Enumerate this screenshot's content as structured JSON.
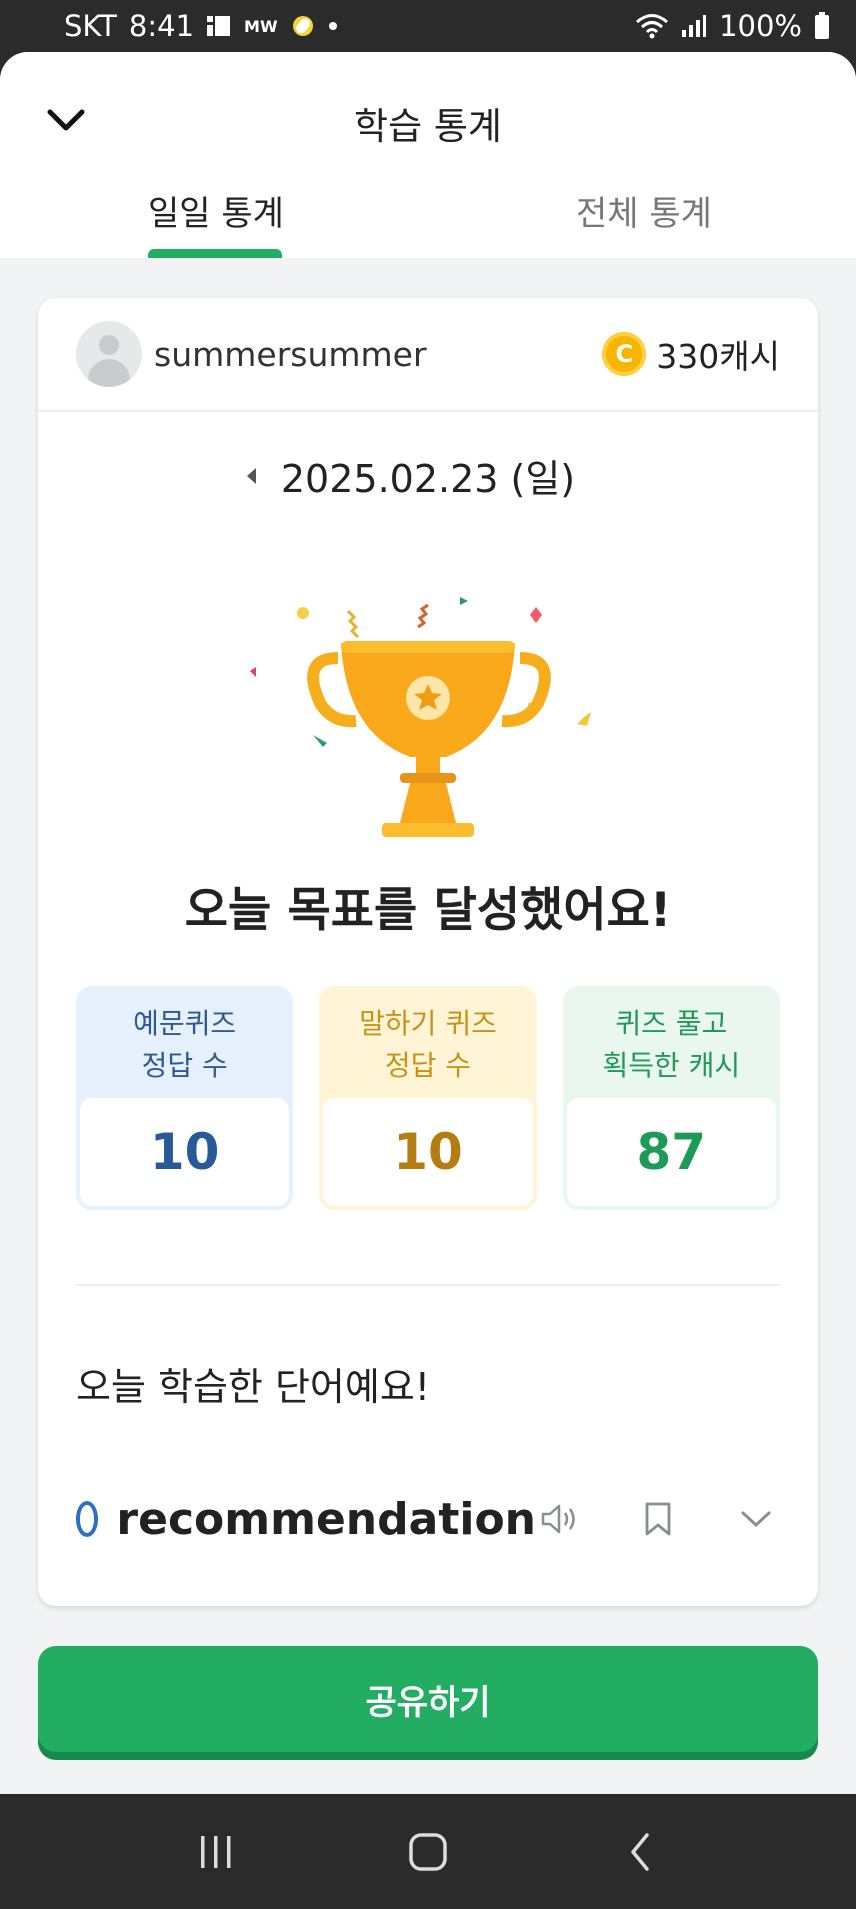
{
  "status_bar": {
    "carrier": "SKT",
    "time": "8:41",
    "battery": "100%"
  },
  "header": {
    "title": "학습 통계",
    "tabs": [
      {
        "label": "일일 통계",
        "active": true
      },
      {
        "label": "전체 통계",
        "active": false
      }
    ]
  },
  "profile": {
    "username": "summersummer",
    "cash": "330캐시"
  },
  "date": "2025.02.23 (일)",
  "goal_message": "오늘 목표를 달성했어요!",
  "stats": [
    {
      "label_line1": "예문퀴즈",
      "label_line2": "정답 수",
      "value": "10"
    },
    {
      "label_line1": "말하기 퀴즈",
      "label_line2": "정답 수",
      "value": "10"
    },
    {
      "label_line1": "퀴즈 풀고",
      "label_line2": "획득한 캐시",
      "value": "87"
    }
  ],
  "words": {
    "title": "오늘 학습한 단어예요!",
    "items": [
      {
        "word": "recommendation"
      }
    ]
  },
  "share_button": "공유하기",
  "colors": {
    "accent_green": "#22ad62",
    "coin": "#f7b500",
    "trophy": "#f9a81c"
  },
  "icons": [
    "chevron-down-icon",
    "coin-icon",
    "trophy-icon",
    "speaker-icon",
    "bookmark-icon",
    "expand-icon"
  ]
}
